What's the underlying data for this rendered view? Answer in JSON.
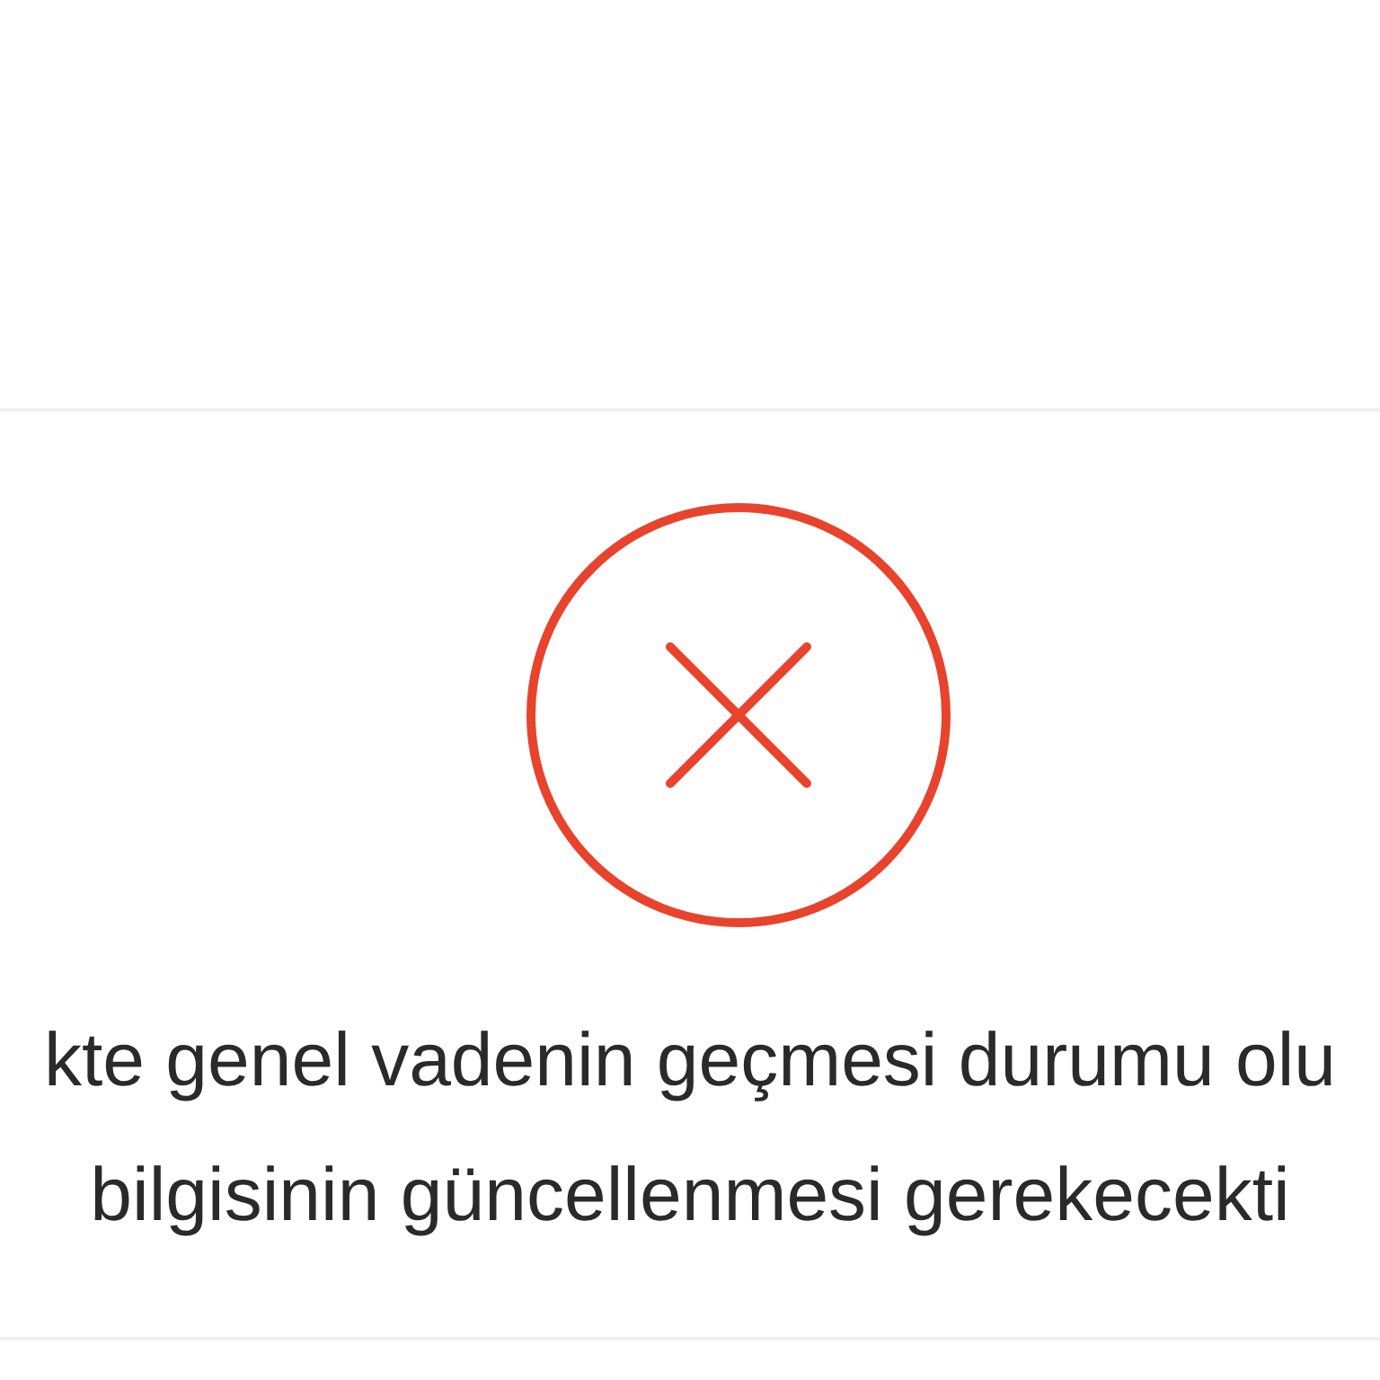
{
  "result": {
    "kind": "error",
    "lines": [
      "kte genel vadenin geçmesi durumu olu",
      "bilgisinin güncellenmesi gerekecekti"
    ]
  }
}
